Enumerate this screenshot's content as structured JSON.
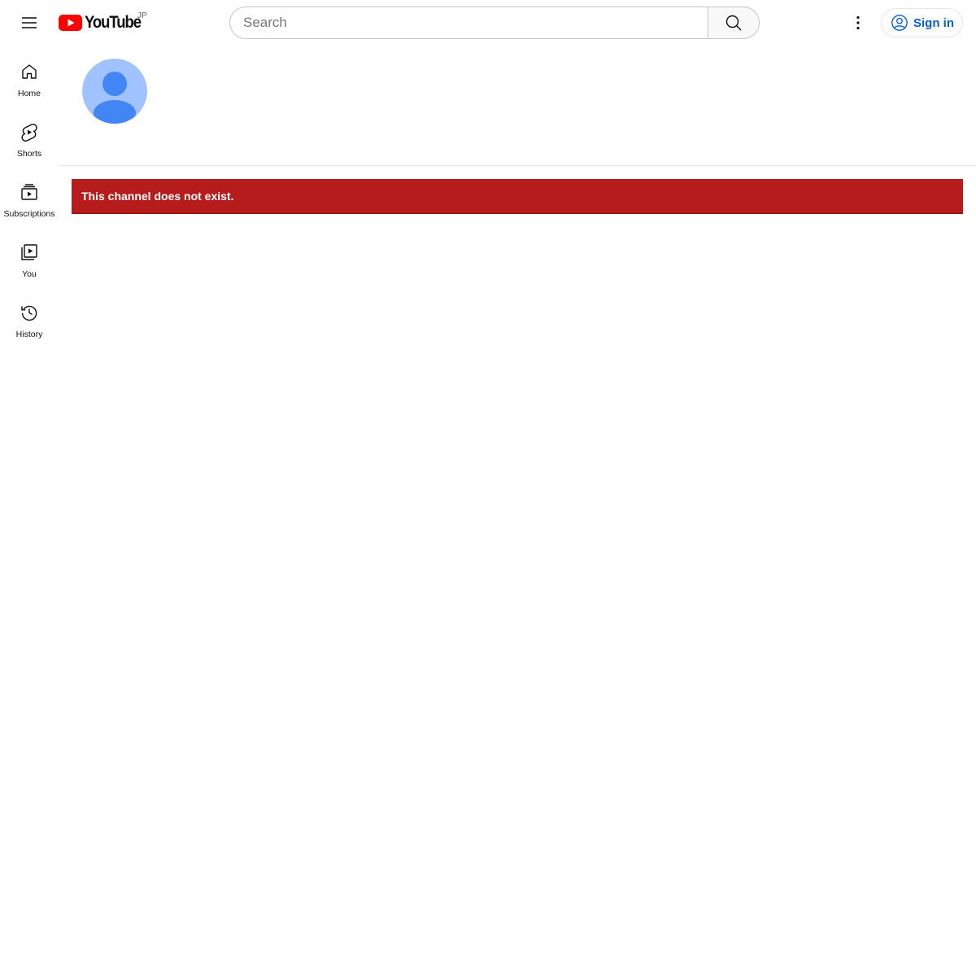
{
  "masthead": {
    "logo_text": "YouTube",
    "country_code": "JP",
    "search_placeholder": "Search",
    "signin_label": "Sign in",
    "brand_red": "#ff0000",
    "link_blue": "#065fd4"
  },
  "guide": {
    "items": [
      {
        "label": "Home",
        "icon": "home-icon"
      },
      {
        "label": "Shorts",
        "icon": "shorts-icon"
      },
      {
        "label": "Subscriptions",
        "icon": "subscriptions-icon"
      },
      {
        "label": "You",
        "icon": "you-icon"
      },
      {
        "label": "History",
        "icon": "history-icon"
      }
    ]
  },
  "channel": {
    "avatar_icon": "default-avatar-icon"
  },
  "error": {
    "message": "This channel does not exist.",
    "color": "#b71c1c"
  }
}
